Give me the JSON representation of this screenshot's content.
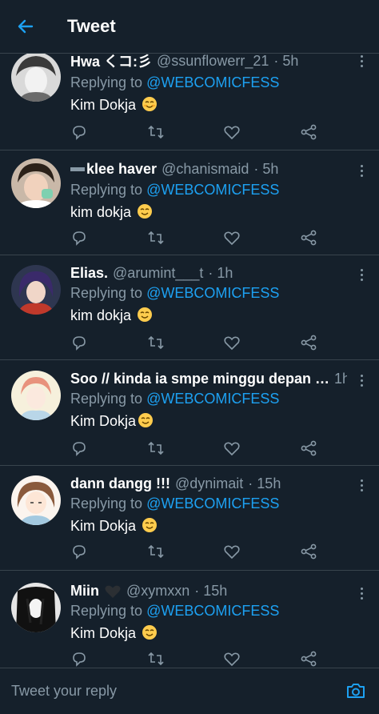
{
  "header": {
    "title": "Tweet"
  },
  "tweets": [
    {
      "name": "Hwa くコ:彡",
      "handle": "@ssunflowerr_21",
      "time": "· 5h",
      "replying_prefix": "Replying to ",
      "replying_to": "@WEBCOMICFESS",
      "text": "Kim Dokja"
    },
    {
      "name": "klee haver",
      "handle": "@chanismaid",
      "time": "· 5h",
      "replying_prefix": "Replying to ",
      "replying_to": "@WEBCOMICFESS",
      "text": "kim dokja"
    },
    {
      "name": "Elias.",
      "handle": "@arumint___t",
      "time": "· 1h",
      "replying_prefix": "Replying to ",
      "replying_to": "@WEBCOMICFESS",
      "text": "kim dokja"
    },
    {
      "name": "Soo // kinda ia smpe minggu depan …",
      "handle": "",
      "time": "1h",
      "replying_prefix": "Replying to ",
      "replying_to": "@WEBCOMICFESS",
      "text": "Kim Dokja"
    },
    {
      "name": "dann dangg !!!",
      "handle": "@dynimait",
      "time": "· 15h",
      "replying_prefix": "Replying to ",
      "replying_to": "@WEBCOMICFESS",
      "text": "Kim Dokja"
    },
    {
      "name": "Miin",
      "handle": "@xymxxn",
      "time": "· 15h",
      "replying_prefix": "Replying to ",
      "replying_to": "@WEBCOMICFESS",
      "text": "Kim Dokja"
    }
  ],
  "footer": {
    "reply_placeholder": "Tweet your reply"
  },
  "colors": {
    "background": "#15202b",
    "accent": "#1da1f2",
    "muted": "#8899a6",
    "divider": "#38444d"
  },
  "icons": [
    "back-arrow-icon",
    "reply-icon",
    "retweet-icon",
    "like-icon",
    "share-icon",
    "more-icon",
    "camera-icon",
    "smiling-emoji-icon"
  ]
}
